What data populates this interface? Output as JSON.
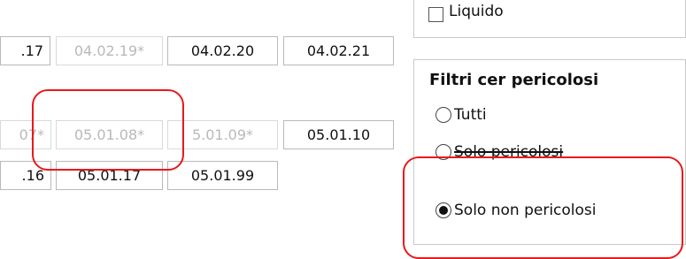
{
  "codes": {
    "row1": [
      {
        "label": ".17",
        "disabled": false
      },
      {
        "label": "04.02.19*",
        "disabled": true
      },
      {
        "label": "04.02.20",
        "disabled": false
      },
      {
        "label": "04.02.21",
        "disabled": false
      }
    ],
    "row2": [
      {
        "label": "07*",
        "disabled": true
      },
      {
        "label": "05.01.08*",
        "disabled": true
      },
      {
        "label": "5.01.09*",
        "disabled": true
      },
      {
        "label": "05.01.10",
        "disabled": false
      }
    ],
    "row3": [
      {
        "label": ".16",
        "disabled": false
      },
      {
        "label": "05.01.17",
        "disabled": false
      },
      {
        "label": "05.01.99",
        "disabled": false
      }
    ]
  },
  "state_filter": {
    "liquido_label": "Liquido",
    "liquido_checked": false
  },
  "cer_filter": {
    "title": "Filtri cer pericolosi",
    "options": [
      {
        "label": "Tutti",
        "selected": false
      },
      {
        "label": "Solo pericolosi",
        "selected": false
      },
      {
        "label": "Solo non pericolosi",
        "selected": true
      }
    ]
  },
  "colors": {
    "annotation": "#e8191c",
    "disabled_text": "#b9b9b9"
  }
}
